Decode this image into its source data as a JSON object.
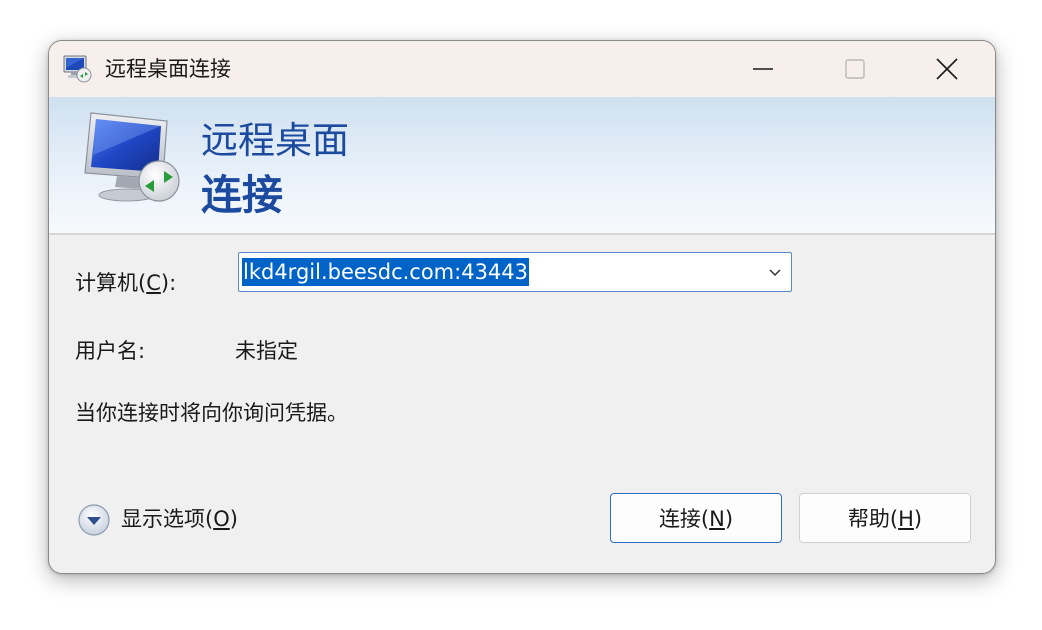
{
  "window": {
    "title": "远程桌面连接"
  },
  "banner": {
    "line1": "远程桌面",
    "line2": "连接"
  },
  "form": {
    "computer_label_prefix": "计算机(",
    "computer_label_key": "C",
    "computer_label_suffix": "):",
    "computer_value": "lkd4rgil.beesdc.com:43443",
    "username_label": "用户名:",
    "username_value": "未指定",
    "note": "当你连接时将向你询问凭据。"
  },
  "footer": {
    "options_prefix": "显示选项(",
    "options_key": "O",
    "options_suffix": ")",
    "connect_prefix": "连接(",
    "connect_key": "N",
    "connect_suffix": ")",
    "help_prefix": "帮助(",
    "help_key": "H",
    "help_suffix": ")"
  },
  "icons": {
    "app": "remote-desktop-icon",
    "minimize": "minimize-icon",
    "maximize": "maximize-icon",
    "close": "close-icon",
    "dropdown": "chevron-down-icon",
    "options": "expand-circle-icon"
  },
  "colors": {
    "accent": "#0063c7",
    "banner_text": "#1b4a9e",
    "titlebar": "#f7efec"
  }
}
